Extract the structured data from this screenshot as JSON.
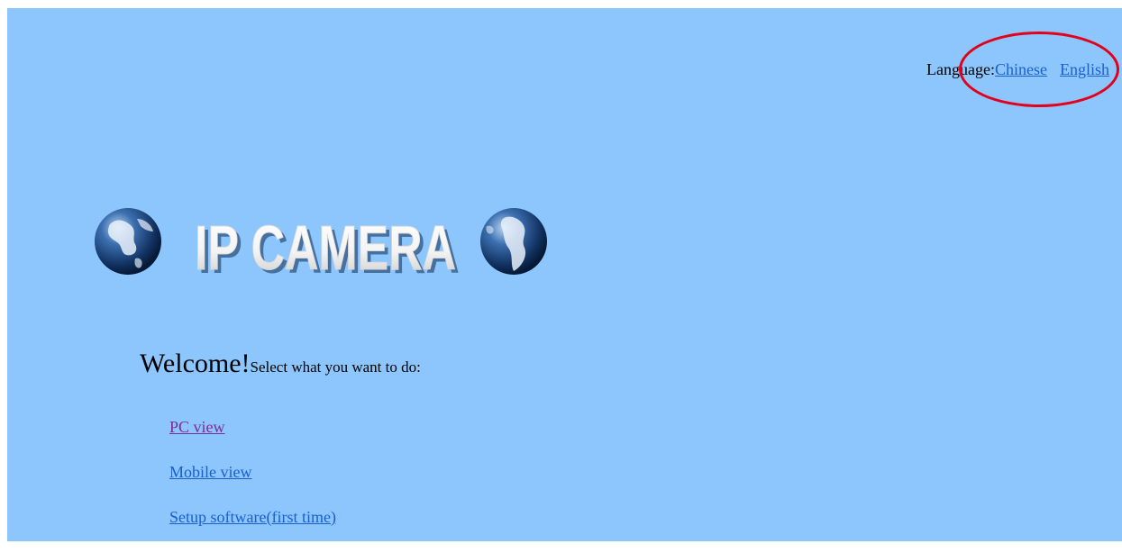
{
  "language_bar": {
    "label": "Language:",
    "options": [
      "Chinese",
      "English"
    ]
  },
  "logo": {
    "text": "IP CAMERA",
    "left_icon": "globe-icon",
    "right_icon": "globe-icon"
  },
  "welcome": {
    "heading": "Welcome!",
    "prompt": "Select what you want to do:"
  },
  "actions": [
    {
      "label": "PC view",
      "state": "visited"
    },
    {
      "label": "Mobile view",
      "state": "normal"
    },
    {
      "label": "Setup software(first time)",
      "state": "normal"
    }
  ],
  "colors": {
    "background": "#8cc6fd",
    "link": "#1a5fd0",
    "visited_link": "#7b2c91",
    "annotation": "#e3001b"
  }
}
